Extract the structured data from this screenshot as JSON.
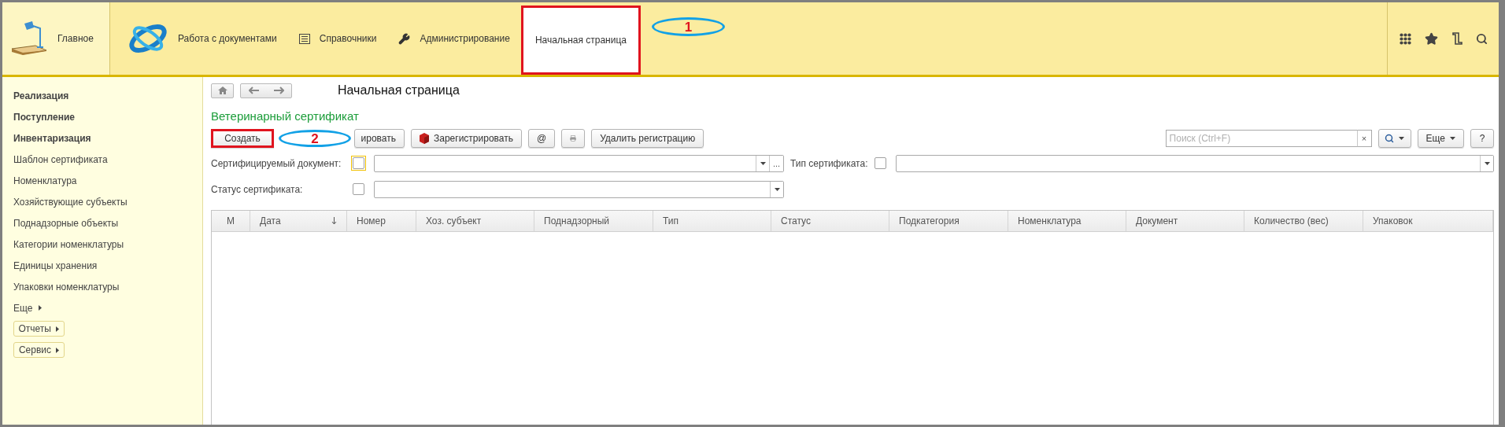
{
  "top_nav": {
    "home": {
      "label": "Главное"
    },
    "sections": [
      {
        "kind": "logo",
        "label": "Работа с документами",
        "selected": false,
        "outlined": false
      },
      {
        "kind": "catalog",
        "label": "Справочники",
        "selected": false,
        "outlined": false
      },
      {
        "kind": "admin",
        "label": "Администрирование",
        "selected": false,
        "outlined": false
      },
      {
        "kind": "plain",
        "label": "Начальная страница",
        "selected": true,
        "outlined": true,
        "callout": "1"
      }
    ]
  },
  "sidebar": {
    "items": [
      {
        "label": "Реализация",
        "kind": "group"
      },
      {
        "label": "Поступление",
        "kind": "group"
      },
      {
        "label": "Инвентаризация",
        "kind": "group"
      },
      {
        "label": "Шаблон сертификата",
        "kind": "link"
      },
      {
        "label": "Номенклатура",
        "kind": "link"
      },
      {
        "label": "Хозяйствующие субъекты",
        "kind": "link"
      },
      {
        "label": "Поднадзорные объекты",
        "kind": "link"
      },
      {
        "label": "Категории номенклатуры",
        "kind": "link"
      },
      {
        "label": "Единицы хранения",
        "kind": "link"
      },
      {
        "label": "Упаковки номенклатуры",
        "kind": "link"
      }
    ],
    "more": "Еще",
    "buttons": [
      "Отчеты",
      "Сервис"
    ]
  },
  "page": {
    "title": "Начальная страница"
  },
  "form": {
    "title": "Ветеринарный сертификат",
    "toolbar": [
      {
        "kind": "text",
        "label": "Создать",
        "outlined": true,
        "callout": "2"
      },
      {
        "kind": "partial",
        "label": "ировать",
        "outlined": false
      },
      {
        "kind": "register",
        "label": "Зарегистрировать",
        "outlined": false
      },
      {
        "kind": "text",
        "label": "@",
        "outlined": false
      },
      {
        "kind": "print",
        "outlined": false
      },
      {
        "kind": "text",
        "label": "Удалить регистрацию",
        "outlined": false
      }
    ],
    "search": {
      "placeholder": "Поиск (Ctrl+F)",
      "clear": "×"
    },
    "more_button": "Еще",
    "help_button": "?",
    "filter_rows": [
      [
        {
          "label": "Сертифицируемый документ:",
          "checked": false,
          "focused": true,
          "select_button": "..."
        },
        {
          "label": "Тип сертификата:",
          "checked": false,
          "focused": false
        }
      ],
      [
        {
          "label": "Статус сертификата:",
          "checked": false,
          "focused": false
        }
      ]
    ]
  },
  "table": {
    "columns": [
      {
        "label": "М",
        "sorted": false
      },
      {
        "label": "Дата",
        "sorted": true
      },
      {
        "label": "Номер",
        "sorted": false
      },
      {
        "label": "Хоз. субъект",
        "sorted": false
      },
      {
        "label": "Поднадзорный",
        "sorted": false
      },
      {
        "label": "Тип",
        "sorted": false
      },
      {
        "label": "Статус",
        "sorted": false
      },
      {
        "label": "Подкатегория",
        "sorted": false
      },
      {
        "label": "Номенклатура",
        "sorted": false
      },
      {
        "label": "Документ",
        "sorted": false
      },
      {
        "label": "Количество (вес)",
        "sorted": false
      },
      {
        "label": "Упаковок",
        "sorted": false
      }
    ]
  }
}
